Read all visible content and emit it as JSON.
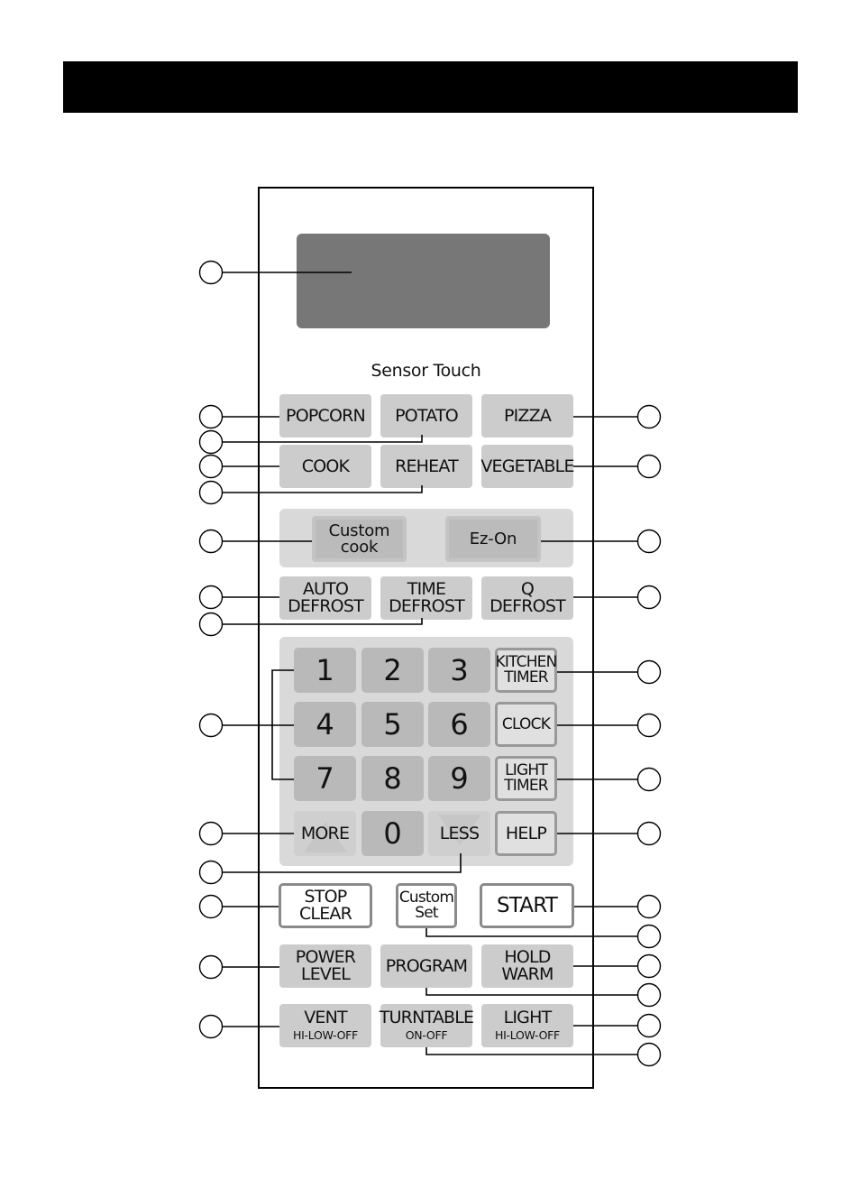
{
  "diagram": {
    "title": "",
    "display": {
      "label": ""
    },
    "sensor_touch_label": "Sensor Touch",
    "sensor_buttons": [
      {
        "id": "popcorn",
        "lines": [
          "POPCORN"
        ]
      },
      {
        "id": "potato",
        "lines": [
          "POTATO"
        ]
      },
      {
        "id": "pizza",
        "lines": [
          "PIZZA"
        ]
      },
      {
        "id": "cook",
        "lines": [
          "COOK"
        ]
      },
      {
        "id": "reheat",
        "lines": [
          "REHEAT"
        ]
      },
      {
        "id": "vegetable",
        "lines": [
          "VEGETABLE"
        ]
      }
    ],
    "custom_buttons": {
      "custom_cook": {
        "line1": "Custom",
        "line2": "cook"
      },
      "ez_on": {
        "label": "Ez-On"
      }
    },
    "defrost_buttons": {
      "auto": {
        "line1": "AUTO",
        "line2": "DEFROST"
      },
      "time": {
        "line1": "TIME",
        "line2": "DEFROST"
      },
      "q": {
        "line1": "Q",
        "line2": "DEFROST"
      }
    },
    "keypad": {
      "digits": [
        "1",
        "2",
        "3",
        "4",
        "5",
        "6",
        "7",
        "8",
        "9",
        "0"
      ],
      "more": "MORE",
      "less": "LESS",
      "kitchen_timer": {
        "line1": "KITCHEN",
        "line2": "TIMER"
      },
      "clock": "CLOCK",
      "light_timer": {
        "line1": "LIGHT",
        "line2": "TIMER"
      },
      "help": "HELP"
    },
    "control_buttons": {
      "stop_clear": {
        "line1": "STOP",
        "line2": "CLEAR"
      },
      "custom_set": {
        "line1": "Custom",
        "line2": "Set"
      },
      "start": "START"
    },
    "bottom_buttons": {
      "power_level": {
        "line1": "POWER",
        "line2": "LEVEL"
      },
      "program": "PROGRAM",
      "hold_warm": {
        "line1": "HOLD",
        "line2": "WARM"
      },
      "vent": {
        "line1": "VENT",
        "sub": "HI-LOW-OFF"
      },
      "turntable": {
        "line1": "TURNTABLE",
        "sub": "ON-OFF"
      },
      "light": {
        "line1": "LIGHT",
        "sub": "HI-LOW-OFF"
      }
    },
    "callouts": {
      "left_count": 14,
      "right_count": 14,
      "labels": "blank numbered circles (numbers not printed)"
    }
  }
}
